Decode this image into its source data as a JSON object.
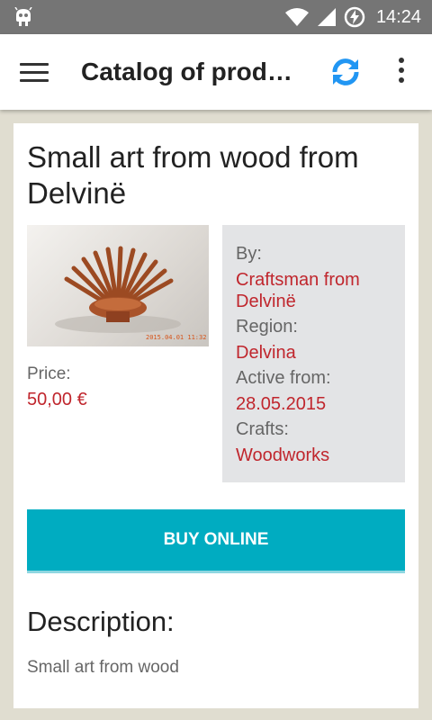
{
  "status_bar": {
    "time": "14:24",
    "icons": [
      "android-notification-icon",
      "wifi-icon",
      "cell-signal-icon",
      "battery-charging-icon"
    ]
  },
  "app_bar": {
    "title": "Catalog of produ…",
    "menu_icon": "hamburger-menu-icon",
    "refresh_icon": "refresh-icon",
    "overflow_icon": "more-vert-icon",
    "accent_color": "#2196f3"
  },
  "product": {
    "title": "Small art from wood from Delvinë",
    "photo_caption": "2015.04.01 11:32",
    "price_label": "Price:",
    "price_value": "50,00 €",
    "info": {
      "by_label": "By:",
      "by_value": "Craftsman from Delvinë",
      "region_label": "Region:",
      "region_value": "Delvina",
      "active_label": "Active from:",
      "active_value": "28.05.2015",
      "crafts_label": "Crafts:",
      "crafts_value": "Woodworks"
    },
    "buy_button": "BUY ONLINE",
    "description_heading": "Description:",
    "description_text": "Small art from wood"
  },
  "colors": {
    "accent_red": "#c0262d",
    "button_teal": "#00acc1",
    "background": "#e0ddd0"
  }
}
